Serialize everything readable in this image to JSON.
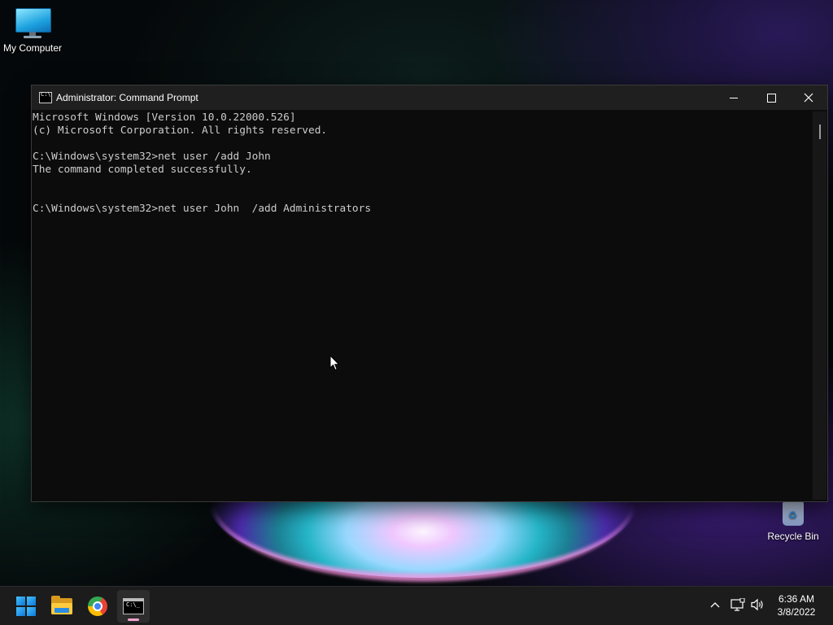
{
  "desktop": {
    "icons": [
      {
        "label": "My Computer",
        "icon": "computer-icon"
      },
      {
        "label": "Recycle Bin",
        "icon": "recycle-bin-icon"
      }
    ]
  },
  "window": {
    "title": "Administrator: Command Prompt",
    "icon": "command-prompt-icon",
    "controls": {
      "minimize": "minimize-icon",
      "maximize": "maximize-icon",
      "close": "close-icon"
    },
    "console_lines": [
      "Microsoft Windows [Version 10.0.22000.526]",
      "(c) Microsoft Corporation. All rights reserved.",
      "",
      "C:\\Windows\\system32>net user /add John",
      "The command completed successfully.",
      "",
      "",
      "C:\\Windows\\system32>net user John  /add Administrators"
    ],
    "colors": {
      "background": "#0c0c0c",
      "text": "#cccccc",
      "titlebar": "#1f1f1f"
    }
  },
  "taskbar": {
    "apps": [
      {
        "name": "Start",
        "icon": "windows-start-icon"
      },
      {
        "name": "File Explorer",
        "icon": "file-explorer-icon"
      },
      {
        "name": "Google Chrome",
        "icon": "chrome-icon"
      },
      {
        "name": "Command Prompt",
        "icon": "command-prompt-icon",
        "active": true
      }
    ],
    "tray": {
      "icons": [
        "chevron-up-icon",
        "network-icon",
        "volume-icon"
      ],
      "time": "6:36 AM",
      "date": "3/8/2022"
    },
    "colors": {
      "background": "#1c1c1c",
      "active_indicator": "#f5a3d0"
    }
  }
}
